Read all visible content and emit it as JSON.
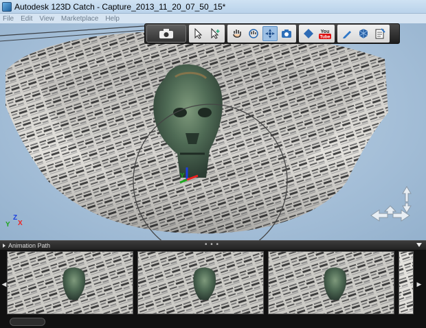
{
  "window": {
    "title": "Autodesk 123D Catch - Capture_2013_11_20_07_50_15*"
  },
  "menu": {
    "items": [
      "File",
      "Edit",
      "View",
      "Marketplace",
      "Help"
    ]
  },
  "toolbar": {
    "buttons": [
      {
        "icon": "camera-icon"
      },
      {
        "icon": "select-arrow-icon"
      },
      {
        "icon": "add-select-icon"
      },
      {
        "icon": "pan-hand-icon"
      },
      {
        "icon": "pan-orbit-icon"
      },
      {
        "icon": "orbit-icon",
        "active": true
      },
      {
        "icon": "camera-view-icon"
      },
      {
        "icon": "flat-view-icon"
      },
      {
        "icon": "youtube-icon",
        "label_top": "You",
        "label_bottom": "Tube"
      },
      {
        "icon": "edit-pen-icon"
      },
      {
        "icon": "export-icon"
      },
      {
        "icon": "notes-icon"
      }
    ]
  },
  "viewport": {
    "axis_triad": {
      "x": "X",
      "y": "Y",
      "z": "Z"
    },
    "gizmo": {
      "x": "X",
      "y": "Y",
      "z": "Z"
    }
  },
  "animation_panel": {
    "title": "Animation Path",
    "dots": "• • •",
    "thumbnails": [
      "frame-1",
      "frame-2",
      "frame-3",
      "frame-4"
    ],
    "nav_left": "◀",
    "nav_right": "▶"
  }
}
